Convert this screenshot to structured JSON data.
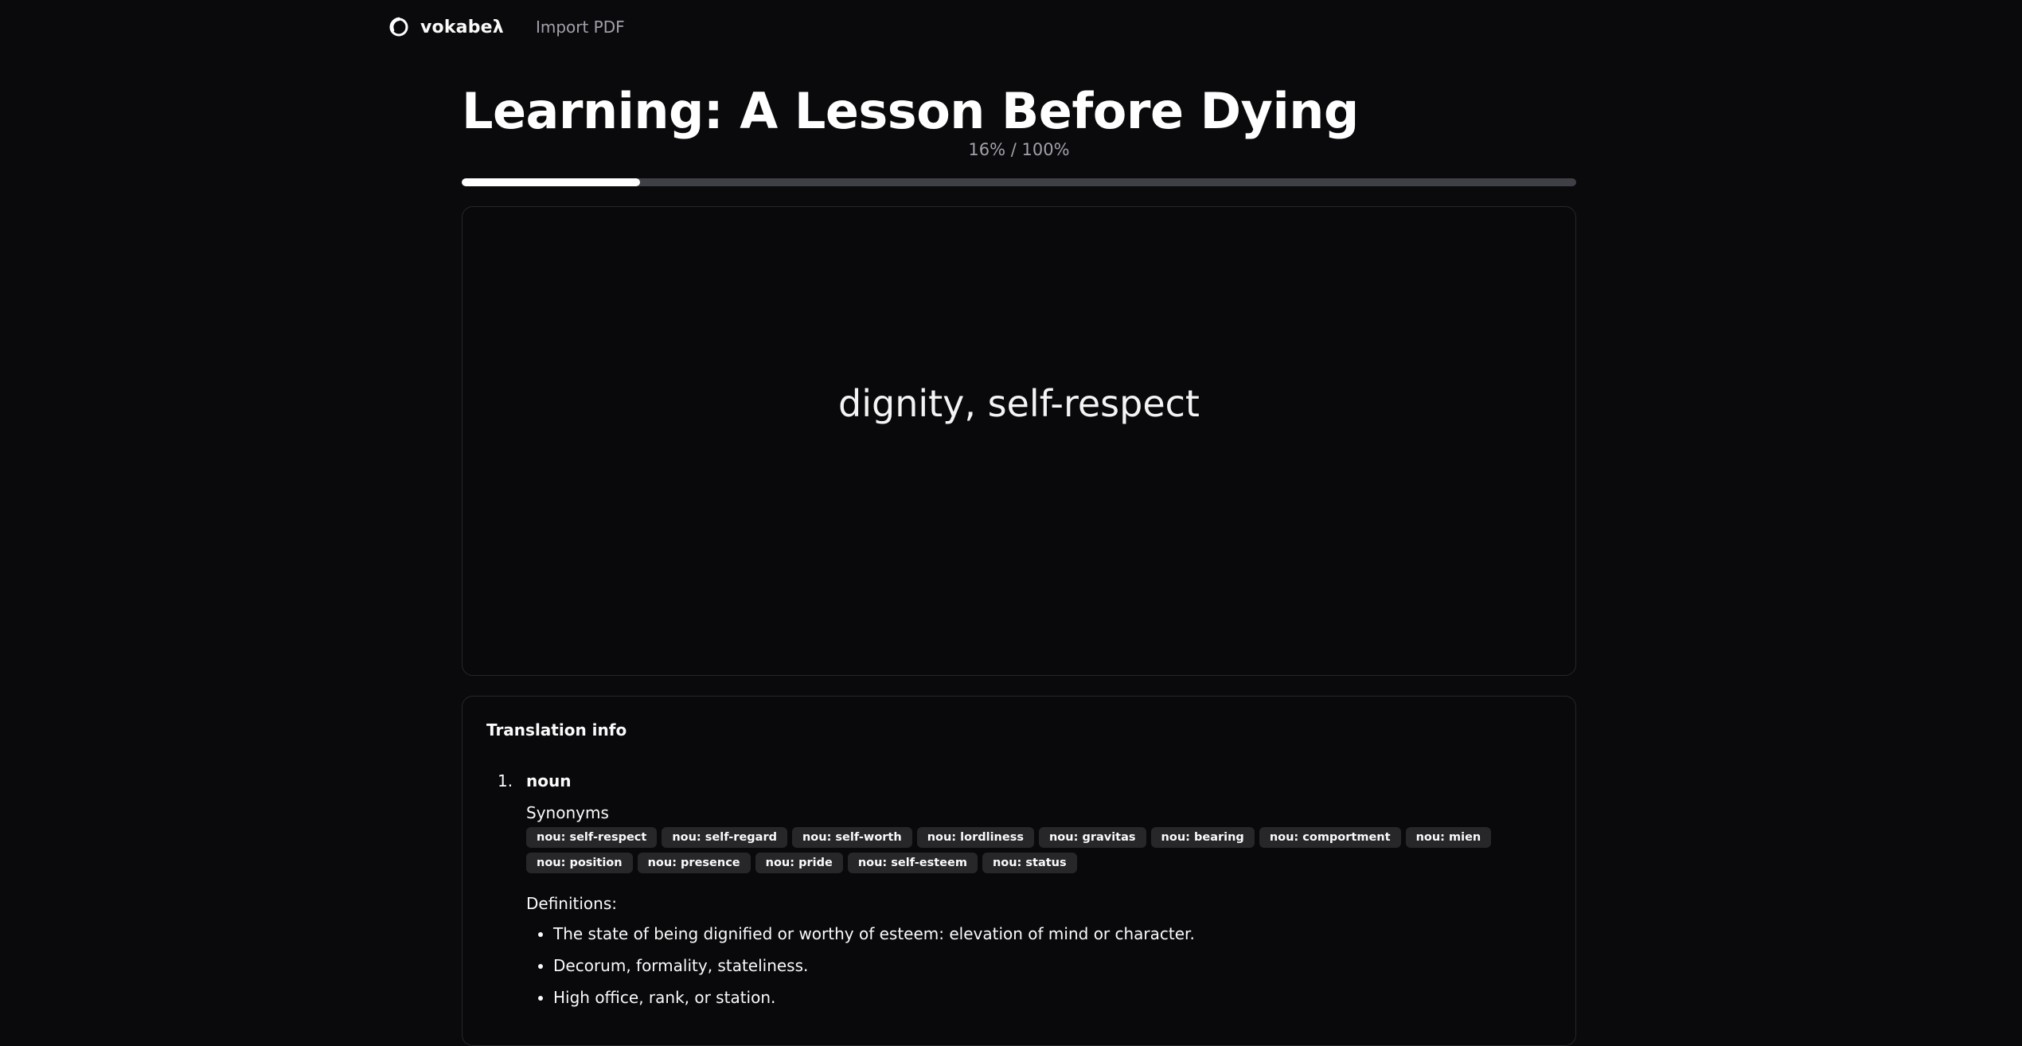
{
  "nav": {
    "brand": "vokabeλ",
    "import_pdf": "Import PDF"
  },
  "lesson": {
    "title": "Learning: A Lesson Before Dying",
    "progress_text": "16% / 100%",
    "progress_fraction": 0.16
  },
  "card": {
    "term": "dignity, self-respect"
  },
  "translation_info": {
    "title": "Translation info",
    "senses": [
      {
        "number": "1.",
        "part_of_speech": "noun",
        "synonyms_label": "Synonyms",
        "synonyms": [
          "nou: self-respect",
          "nou: self-regard",
          "nou: self-worth",
          "nou: lordliness",
          "nou: gravitas",
          "nou: bearing",
          "nou: comportment",
          "nou: mien",
          "nou: position",
          "nou: presence",
          "nou: pride",
          "nou: self-esteem",
          "nou: status"
        ],
        "definitions_label": "Definitions:",
        "definitions": [
          "The state of being dignified or worthy of esteem: elevation of mind or character.",
          "Decorum, formality, stateliness.",
          "High office, rank, or station."
        ]
      }
    ]
  },
  "colors": {
    "background": "#0a0a0c",
    "progress_fill": "#ffffff",
    "progress_track": "#3f3f46",
    "tag_bg": "#27272a",
    "card_border": "#27272a"
  },
  "icons": {
    "brand": "brand-logo-icon"
  }
}
